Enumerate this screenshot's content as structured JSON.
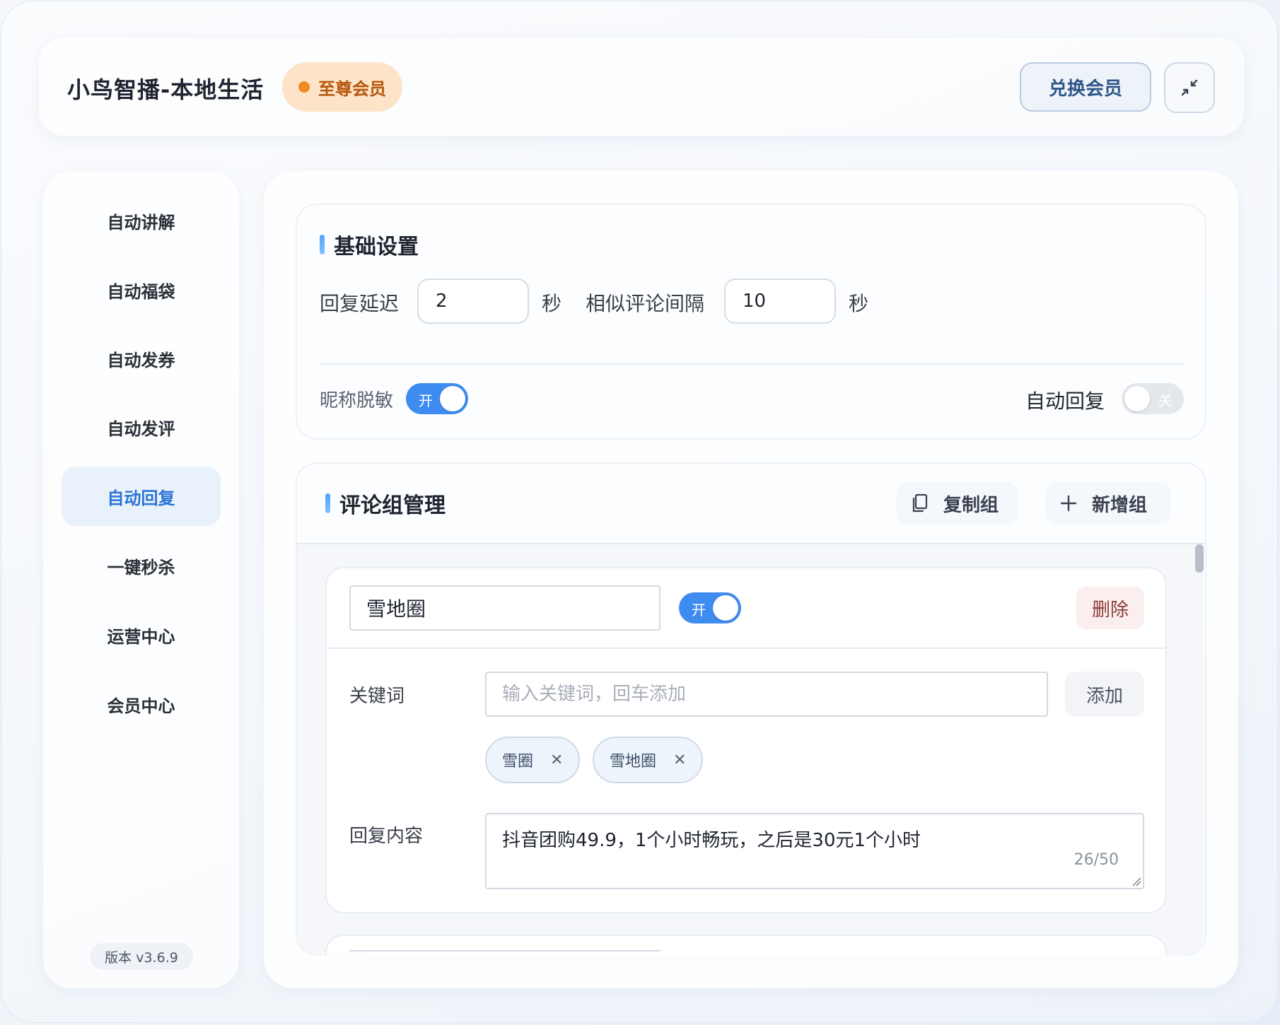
{
  "header": {
    "app_title": "小鸟智播-本地生活",
    "vip_label": "至尊会员",
    "redeem_label": "兑换会员",
    "collapse_icon": "collapse-arrows-icon"
  },
  "sidebar": {
    "items": [
      {
        "label": "自动讲解"
      },
      {
        "label": "自动福袋"
      },
      {
        "label": "自动发券"
      },
      {
        "label": "自动发评"
      },
      {
        "label": "自动回复",
        "active": true
      },
      {
        "label": "一键秒杀"
      },
      {
        "label": "运营中心"
      },
      {
        "label": "会员中心"
      }
    ],
    "version": "版本  v3.6.9"
  },
  "basic": {
    "title": "基础设置",
    "reply_delay_label": "回复延迟",
    "reply_delay_value": "2",
    "unit_seconds": "秒",
    "similar_interval_label": "相似评论间隔",
    "similar_interval_value": "10",
    "nickname_mask_label": "昵称脱敏",
    "nickname_mask_state": "开",
    "auto_reply_label": "自动回复",
    "auto_reply_state": "关"
  },
  "groups": {
    "title": "评论组管理",
    "copy_label": "复制组",
    "add_label": "新增组",
    "items": [
      {
        "name": "雪地圈",
        "state": "开",
        "delete_label": "删除",
        "keyword_label": "关键词",
        "keyword_placeholder": "输入关键词，回车添加",
        "add_label": "添加",
        "tags": [
          "雪圈",
          "雪地圈"
        ],
        "reply_label": "回复内容",
        "reply_text": "抖音团购49.9，1个小时畅玩，之后是30元1个小时",
        "reply_count": "26/50"
      }
    ]
  },
  "colors": {
    "accent": "#3f8cf0",
    "vip_bg": "#fde4c9",
    "vip_text": "#b6560b"
  }
}
